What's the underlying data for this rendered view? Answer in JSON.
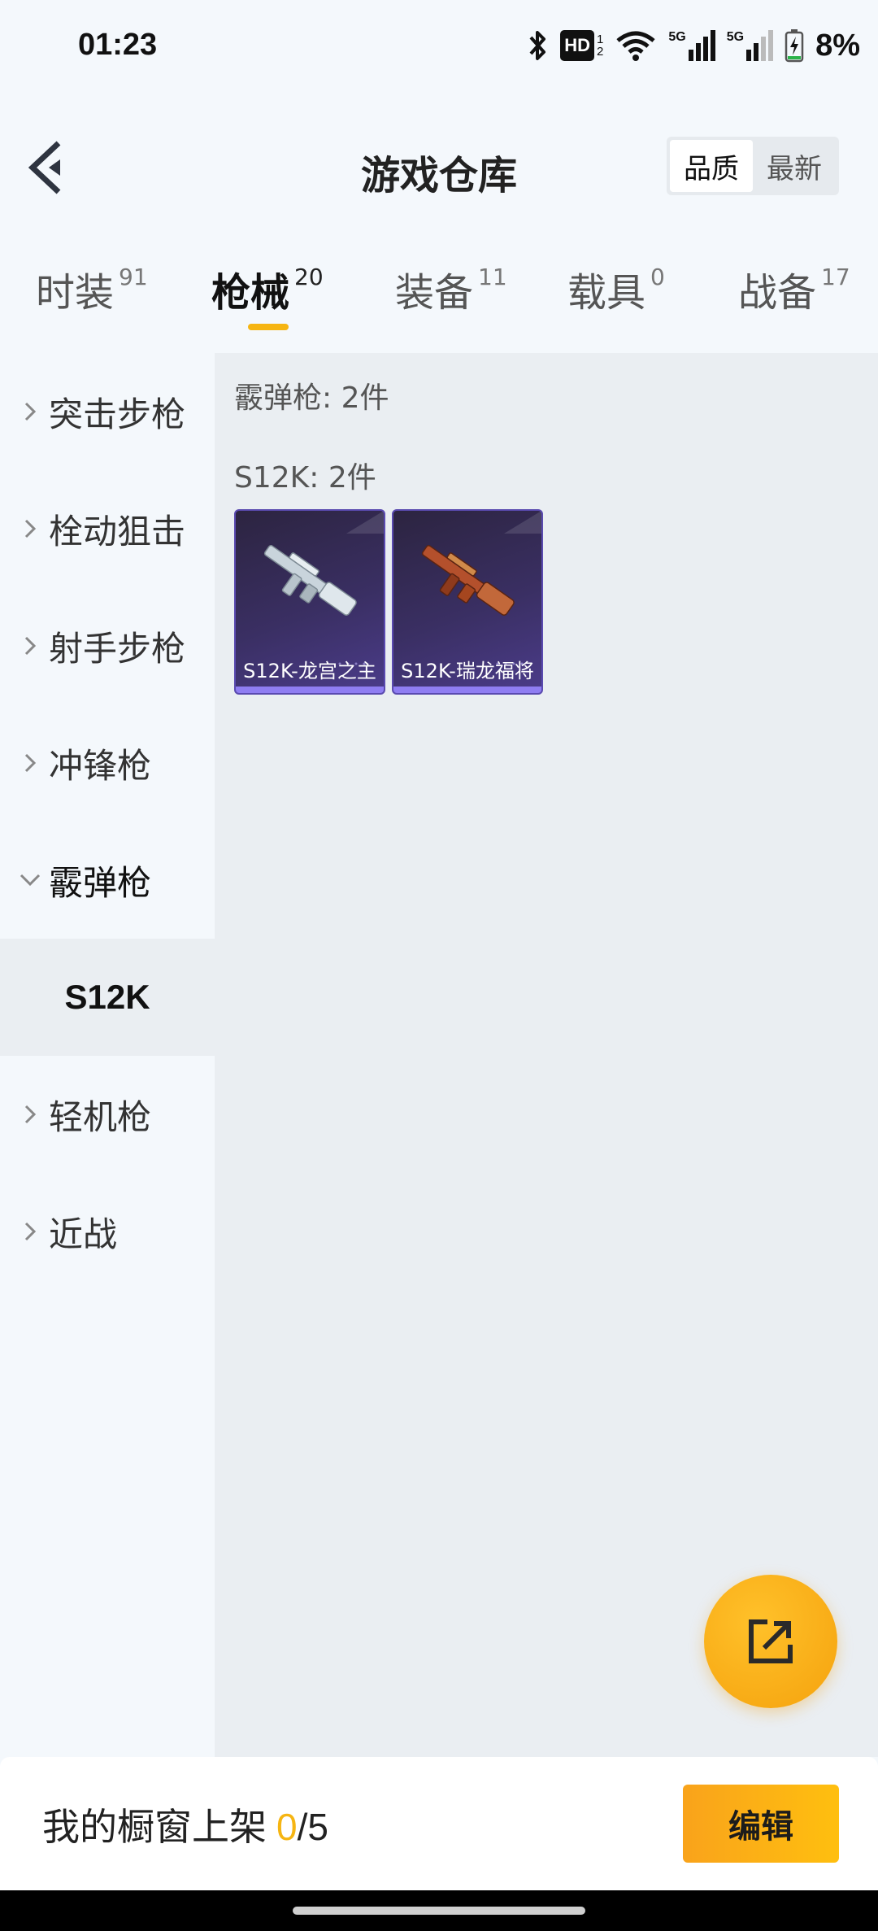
{
  "status_bar": {
    "time": "01:23",
    "hd_label": "HD",
    "net_a": "5G",
    "net_b": "5G",
    "battery": "8%"
  },
  "header": {
    "title": "游戏仓库",
    "sort_options": [
      "品质",
      "最新"
    ],
    "active_sort": "品质"
  },
  "tabs": [
    {
      "label": "时装",
      "count": "91"
    },
    {
      "label": "枪械",
      "count": "20"
    },
    {
      "label": "装备",
      "count": "11"
    },
    {
      "label": "载具",
      "count": "0"
    },
    {
      "label": "战备",
      "count": "17"
    }
  ],
  "active_tab": "枪械",
  "sidebar": {
    "items": [
      {
        "label": "突击步枪"
      },
      {
        "label": "栓动狙击"
      },
      {
        "label": "射手步枪"
      },
      {
        "label": "冲锋枪"
      },
      {
        "label": "霰弹枪"
      },
      {
        "label": "轻机枪"
      },
      {
        "label": "近战"
      }
    ],
    "expanded": "霰弹枪",
    "sub_item": "S12K"
  },
  "content": {
    "group_title": "霰弹枪: 2件",
    "sub_title": "S12K: 2件",
    "items": [
      {
        "name": "S12K-龙宫之主",
        "skin_color": "#c9d4dc"
      },
      {
        "name": "S12K-瑞龙福将",
        "skin_color": "#b4502c"
      }
    ]
  },
  "bottom": {
    "shelf_label": "我的橱窗上架",
    "shelf_count": "0",
    "shelf_total": "/5",
    "edit_label": "编辑"
  },
  "colors": {
    "accent": "#f6b512",
    "card_purple": "#3a2f63"
  }
}
